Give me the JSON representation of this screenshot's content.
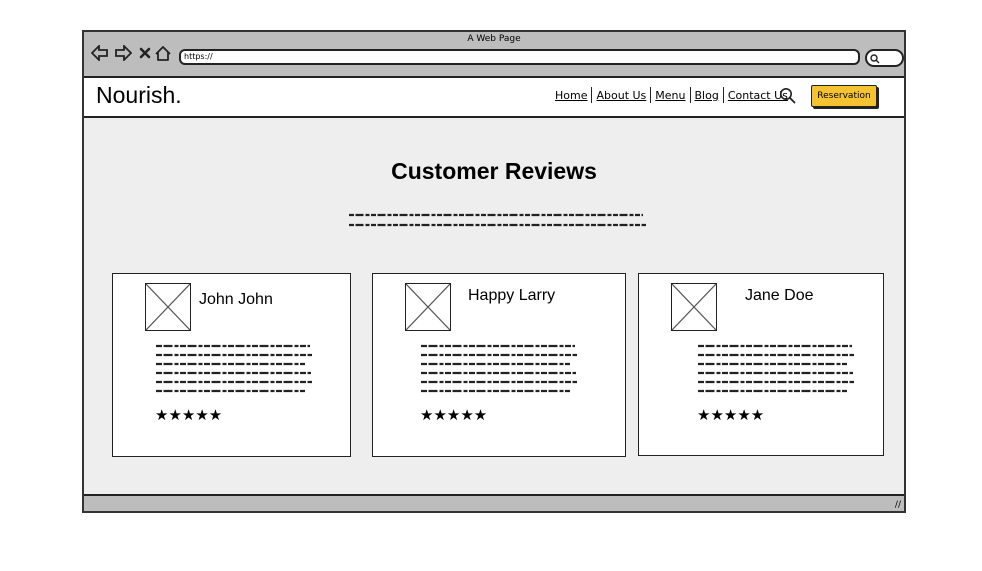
{
  "window": {
    "title": "A Web Page",
    "address": "https://"
  },
  "site": {
    "logo": "Nourish.",
    "nav": [
      "Home",
      "About Us",
      "Menu",
      "Blog",
      "Contact Us"
    ],
    "reservation_label": "Reservation"
  },
  "section": {
    "title": "Customer Reviews"
  },
  "reviews": [
    {
      "name": "John John",
      "rating": "★★★★★"
    },
    {
      "name": "Happy Larry",
      "rating": "★★★★★"
    },
    {
      "name": "Jane Doe",
      "rating": "★★★★★"
    }
  ],
  "colors": {
    "accent": "#f5c332",
    "frame": "#bdbdbd",
    "content_bg": "#eeeeee"
  }
}
